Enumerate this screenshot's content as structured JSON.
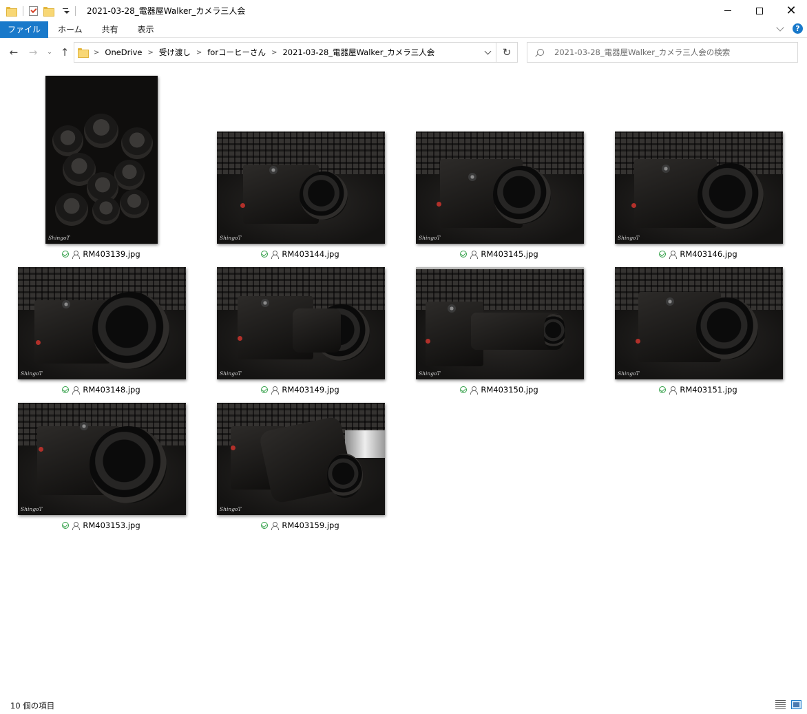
{
  "window": {
    "title": "2021-03-28_電器屋Walker_カメラ三人会"
  },
  "ribbon": {
    "tabs": [
      "ファイル",
      "ホーム",
      "共有",
      "表示"
    ],
    "help_label": "?"
  },
  "address": {
    "crumbs": [
      "OneDrive",
      "受け渡し",
      "forコーヒーさん",
      "2021-03-28_電器屋Walker_カメラ三人会"
    ]
  },
  "search": {
    "placeholder": "2021-03-28_電器屋Walker_カメラ三人会の検索"
  },
  "files": [
    {
      "name": "RM403139.jpg"
    },
    {
      "name": "RM403144.jpg"
    },
    {
      "name": "RM403145.jpg"
    },
    {
      "name": "RM403146.jpg"
    },
    {
      "name": "RM403148.jpg"
    },
    {
      "name": "RM403149.jpg"
    },
    {
      "name": "RM403150.jpg"
    },
    {
      "name": "RM403151.jpg"
    },
    {
      "name": "RM403153.jpg"
    },
    {
      "name": "RM403159.jpg"
    }
  ],
  "watermark": "ShingoT",
  "status": {
    "item_count": "10 個の項目"
  },
  "colors": {
    "accent": "#1979ca",
    "sync_ok": "#2e9e44"
  }
}
